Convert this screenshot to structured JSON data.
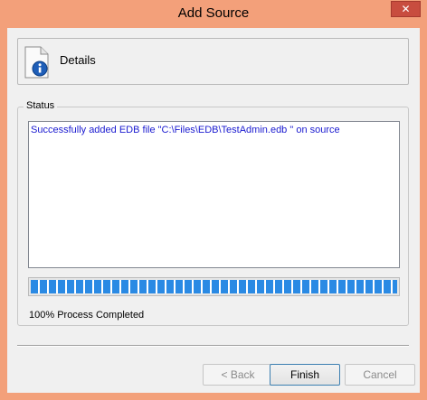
{
  "window": {
    "title": "Add Source",
    "close_label": "✕"
  },
  "header": {
    "label": "Details",
    "icon": "document-info-icon"
  },
  "status": {
    "group_label": "Status",
    "message": "Successfully added EDB file \"C:\\Files\\EDB\\TestAdmin.edb \" on source",
    "progress_fraction": 1.0,
    "progress_text": "100% Process Completed"
  },
  "buttons": {
    "back": "< Back",
    "finish": "Finish",
    "cancel": "Cancel"
  },
  "colors": {
    "accent": "#f3a07a",
    "close": "#c84d3f",
    "progress": "#2a8ae4",
    "status_text": "#1a1ad0"
  }
}
